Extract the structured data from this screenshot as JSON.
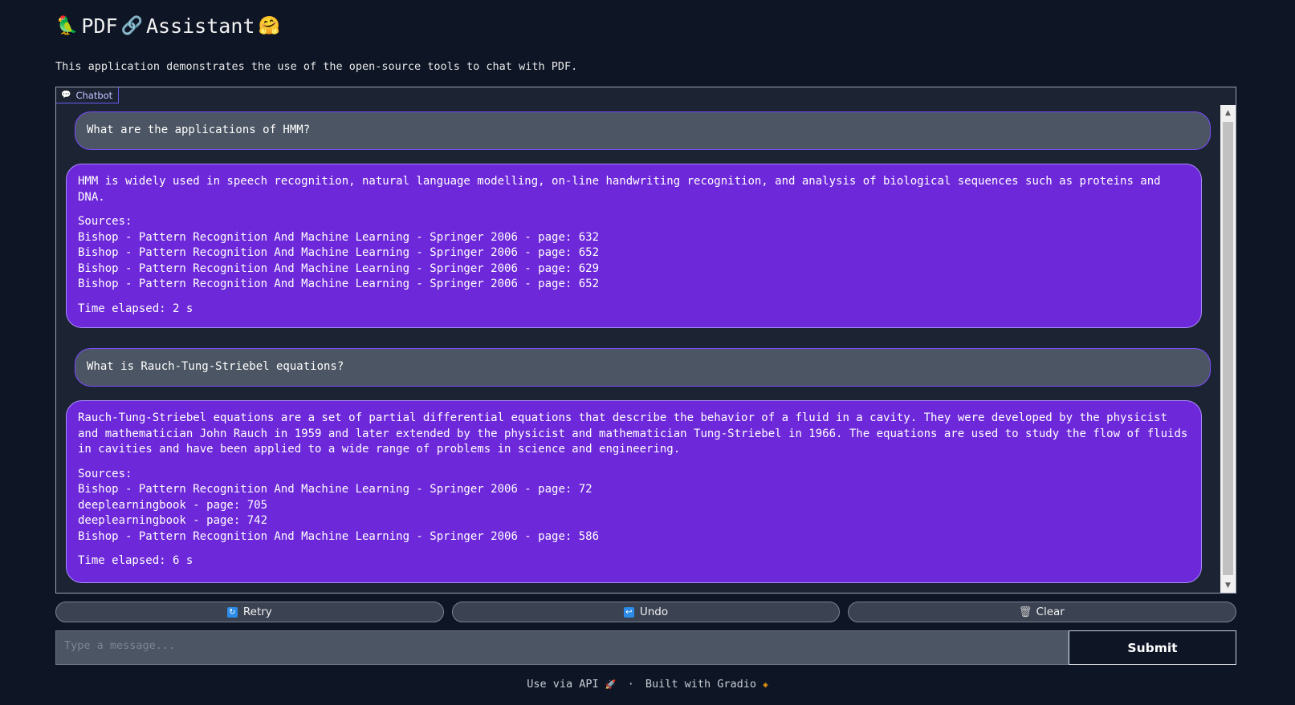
{
  "header": {
    "title_prefix_icon": "parrot-emoji",
    "title_word1": "PDF",
    "title_link_icon": "link-emoji",
    "title_word2": "Assistant",
    "title_suffix_icon": "hugging-face-emoji",
    "description": "This application demonstrates the use of the open-source tools to chat with PDF."
  },
  "chatbot": {
    "label": "Chatbot",
    "label_icon": "chat-bubble-icon",
    "messages": [
      {
        "role": "user",
        "text": "What are the applications of HMM?"
      },
      {
        "role": "bot",
        "answer": "HMM is widely used in speech recognition, natural language modelling, on-line handwriting recognition, and analysis of biological sequences such as proteins and DNA.",
        "sources_label": "Sources:",
        "sources": [
          "Bishop - Pattern Recognition And Machine Learning - Springer 2006 - page: 632",
          "Bishop - Pattern Recognition And Machine Learning - Springer 2006 - page: 652",
          "Bishop - Pattern Recognition And Machine Learning - Springer 2006 - page: 629",
          "Bishop - Pattern Recognition And Machine Learning - Springer 2006 - page: 652"
        ],
        "time": "Time elapsed: 2 s"
      },
      {
        "role": "user",
        "text": "What is Rauch-Tung-Striebel equations?"
      },
      {
        "role": "bot",
        "answer": "Rauch-Tung-Striebel equations are a set of partial differential equations that describe the behavior of a fluid in a cavity. They were developed by the physicist and mathematician John Rauch in 1959 and later extended by the physicist and mathematician Tung-Striebel in 1966. The equations are used to study the flow of fluids in cavities and have been applied to a wide range of problems in science and engineering.",
        "sources_label": "Sources:",
        "sources": [
          "Bishop - Pattern Recognition And Machine Learning - Springer 2006 - page: 72",
          "deeplearningbook - page: 705",
          "deeplearningbook - page: 742",
          "Bishop - Pattern Recognition And Machine Learning - Springer 2006 - page: 586"
        ],
        "time": "Time elapsed: 6 s"
      }
    ]
  },
  "buttons": {
    "retry": {
      "label": "Retry",
      "icon": "retry-icon"
    },
    "undo": {
      "label": "Undo",
      "icon": "undo-icon"
    },
    "clear": {
      "label": "Clear",
      "icon": "trash-icon"
    }
  },
  "input": {
    "placeholder": "Type a message...",
    "value": "",
    "submit_label": "Submit"
  },
  "footer": {
    "api_text": "Use via API",
    "api_icon": "rocket-icon",
    "separator": "·",
    "built_text": "Built with Gradio",
    "gradio_icon": "gradio-logo-icon"
  },
  "colors": {
    "background": "#0e1626",
    "panel": "#1c2434",
    "user_bubble": "#4b5563",
    "bot_bubble": "#6d28d9",
    "accent": "#7c4dff"
  }
}
